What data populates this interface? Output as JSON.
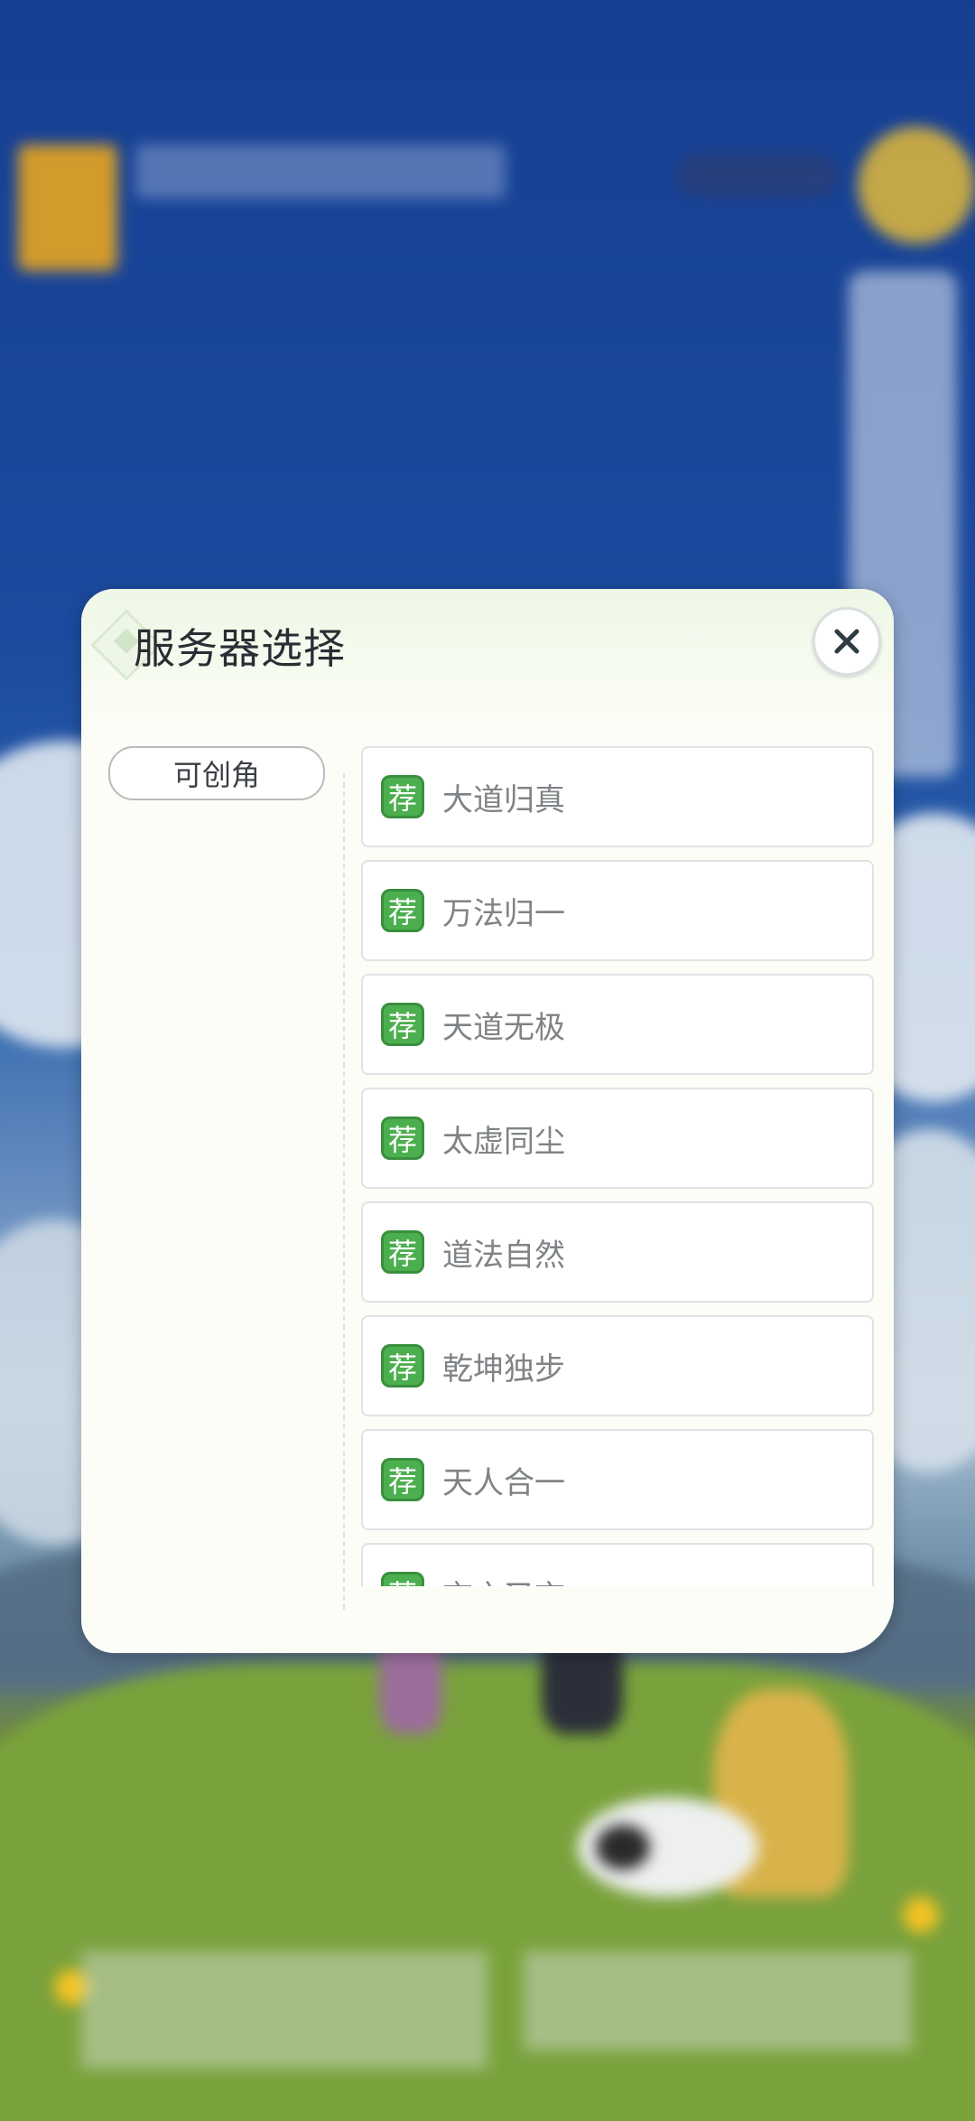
{
  "modal": {
    "title": "服务器选择",
    "close_icon": "close-icon"
  },
  "tabs": [
    {
      "label": "可创角"
    }
  ],
  "servers": [
    {
      "badge": "荐",
      "name": "大道归真"
    },
    {
      "badge": "荐",
      "name": "万法归一"
    },
    {
      "badge": "荐",
      "name": "天道无极"
    },
    {
      "badge": "荐",
      "name": "太虚同尘"
    },
    {
      "badge": "荐",
      "name": "道法自然"
    },
    {
      "badge": "荐",
      "name": "乾坤独步"
    },
    {
      "badge": "荐",
      "name": "天人合一"
    },
    {
      "badge": "荐",
      "name": "玄之又玄"
    }
  ],
  "colors": {
    "badge_green": "#4caf4f",
    "modal_bg": "#fcfdf7",
    "title_text": "#2a2d33",
    "server_text": "#7f8386"
  }
}
